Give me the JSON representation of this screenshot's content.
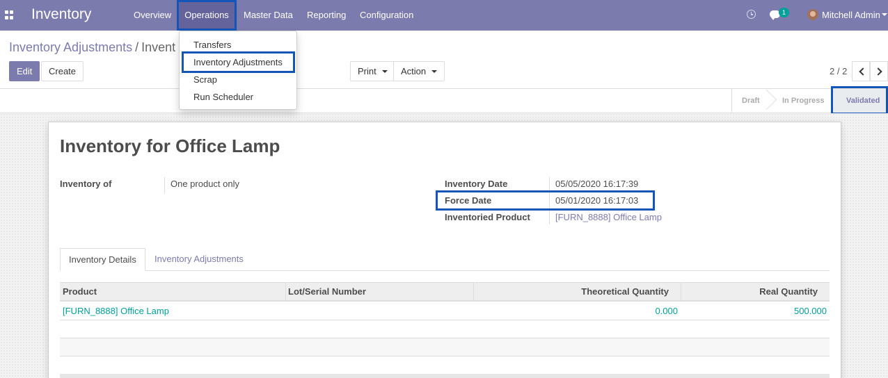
{
  "navbar": {
    "app_title": "Inventory",
    "menu": [
      {
        "label": "Overview"
      },
      {
        "label": "Operations"
      },
      {
        "label": "Master Data"
      },
      {
        "label": "Reporting"
      },
      {
        "label": "Configuration"
      }
    ],
    "chat_badge": "1",
    "user_name": "Mitchell Admin"
  },
  "operations_menu": {
    "items": [
      {
        "label": "Transfers"
      },
      {
        "label": "Inventory Adjustments"
      },
      {
        "label": "Scrap"
      },
      {
        "label": "Run Scheduler"
      }
    ]
  },
  "breadcrumb": {
    "parent": "Inventory Adjustments",
    "separator": "/",
    "current": "Invent"
  },
  "buttons": {
    "edit": "Edit",
    "create": "Create",
    "print": "Print",
    "action": "Action"
  },
  "pager": {
    "value": "2 / 2"
  },
  "statusbar": {
    "steps": [
      "Draft",
      "In Progress",
      "Validated"
    ],
    "current": "Validated"
  },
  "form": {
    "title": "Inventory for Office Lamp",
    "inventory_of_label": "Inventory of",
    "inventory_of_value": "One product only",
    "inventory_date_label": "Inventory Date",
    "inventory_date_value": "05/05/2020 16:17:39",
    "force_date_label": "Force Date",
    "force_date_value": "05/01/2020 16:17:03",
    "inventoried_product_label": "Inventoried Product",
    "inventoried_product_value": "[FURN_8888] Office Lamp"
  },
  "tabs": [
    {
      "label": "Inventory Details",
      "active": true
    },
    {
      "label": "Inventory Adjustments",
      "active": false
    }
  ],
  "table": {
    "headers": [
      "Product",
      "Lot/Serial Number",
      "Theoretical Quantity",
      "Real Quantity"
    ],
    "rows": [
      {
        "product": "[FURN_8888] Office Lamp",
        "lot": "",
        "theoretical": "0.000",
        "real": "500.000"
      }
    ]
  },
  "colors": {
    "brand": "#7c7bad",
    "link_teal": "#00a09d",
    "highlight": "#1456b8"
  }
}
